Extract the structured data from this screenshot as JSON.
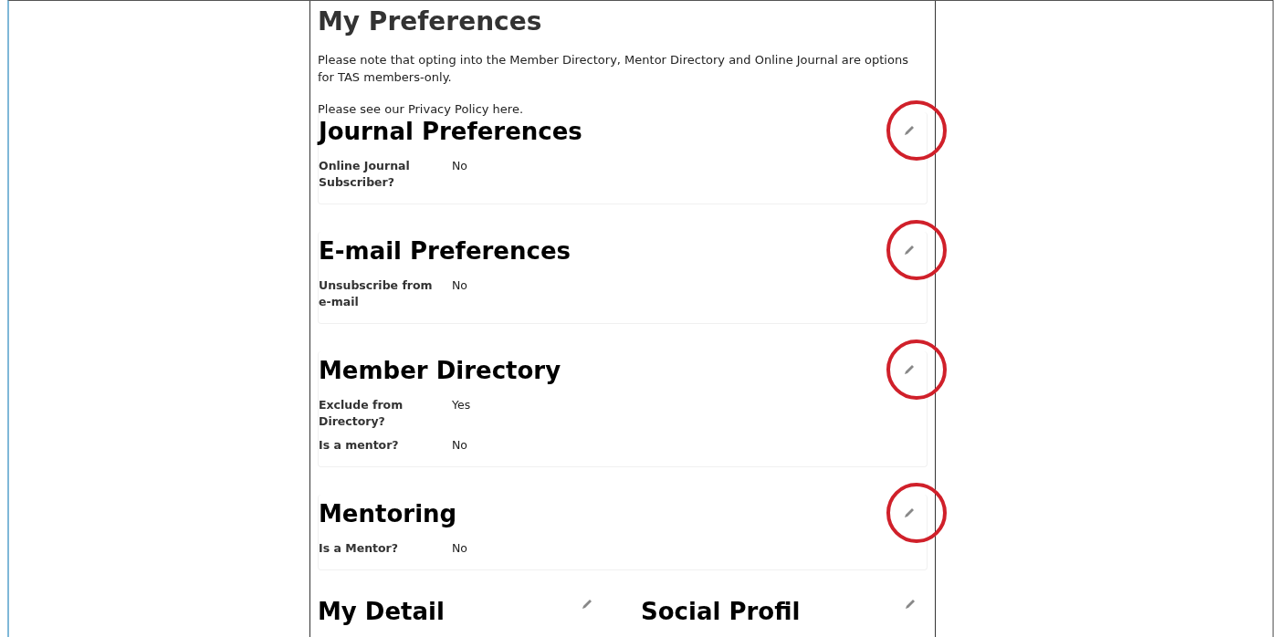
{
  "page": {
    "title": "My Preferences",
    "note": "Please note that opting into the Member Directory, Mentor Directory and Online Journal are options for TAS members-only.",
    "privacy": "Please see our Privacy Policy here."
  },
  "sections": [
    {
      "title": "Journal Preferences",
      "highlighted": true,
      "fields": [
        {
          "label": "Online Journal Subscriber?",
          "value": "No"
        }
      ]
    },
    {
      "title": "E-mail Preferences",
      "highlighted": true,
      "fields": [
        {
          "label": "Unsubscribe from e-mail",
          "value": "No"
        }
      ]
    },
    {
      "title": "Member Directory",
      "highlighted": true,
      "fields": [
        {
          "label": "Exclude from Directory?",
          "value": "Yes"
        },
        {
          "label": "Is a mentor?",
          "value": "No"
        }
      ]
    },
    {
      "title": "Mentoring",
      "highlighted": true,
      "fields": [
        {
          "label": "Is a Mentor?",
          "value": "No"
        }
      ]
    }
  ],
  "bottom_sections": [
    {
      "title": "My Detail"
    },
    {
      "title": "Social Profil"
    }
  ]
}
